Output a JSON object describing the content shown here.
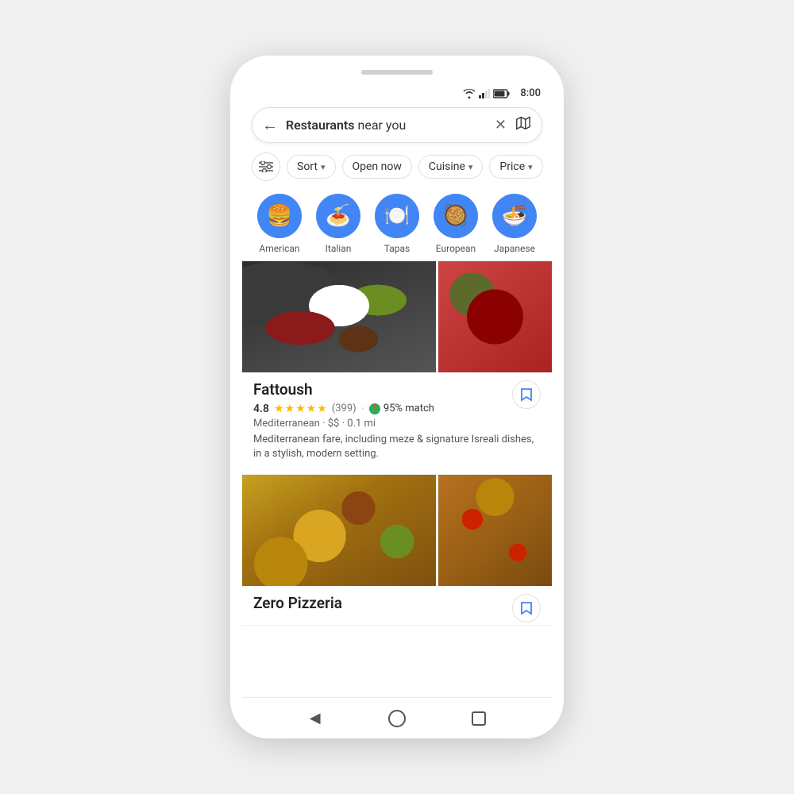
{
  "phone": {
    "status_bar": {
      "time": "8:00"
    },
    "search_bar": {
      "query_bold": "Restaurants",
      "query_rest": " near you",
      "back_label": "←",
      "clear_label": "✕",
      "map_label": "⬡"
    },
    "filters": {
      "filter_icon_label": "⊟",
      "buttons": [
        {
          "label": "Sort",
          "has_arrow": true
        },
        {
          "label": "Open now",
          "has_arrow": false
        },
        {
          "label": "Cuisine",
          "has_arrow": true
        },
        {
          "label": "Price",
          "has_arrow": true
        }
      ]
    },
    "categories": [
      {
        "label": "American",
        "icon": "🍔"
      },
      {
        "label": "Italian",
        "icon": "🍝"
      },
      {
        "label": "Tapas",
        "icon": "🍽️"
      },
      {
        "label": "European",
        "icon": "🥘"
      },
      {
        "label": "Japanese",
        "icon": "🍜"
      }
    ],
    "restaurants": [
      {
        "name": "Fattoush",
        "rating": "4.8",
        "review_count": "(399)",
        "match": "95% match",
        "cuisine": "Mediterranean",
        "price": "$$",
        "distance": "0.1 mi",
        "description": "Mediterranean fare, including meze & signature Isreali dishes, in a stylish, modern setting.",
        "bookmarked": false
      },
      {
        "name": "Zero Pizzeria",
        "rating": "",
        "review_count": "",
        "match": "",
        "cuisine": "",
        "price": "",
        "distance": "",
        "description": ""
      }
    ],
    "nav": {
      "back": "◀",
      "home": "",
      "square": ""
    }
  }
}
